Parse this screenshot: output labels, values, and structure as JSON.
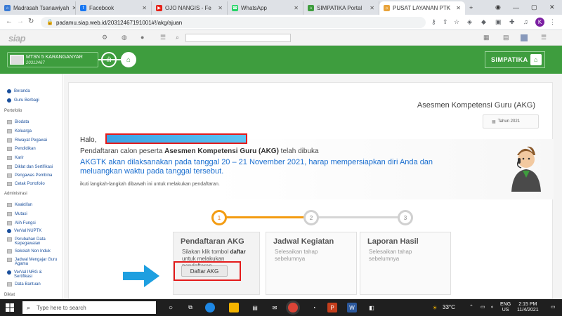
{
  "browser": {
    "tabs": [
      {
        "label": "Madrasah Tsanawiyah",
        "color": "#3a7bd5",
        "glyph": "⌂"
      },
      {
        "label": "Facebook",
        "color": "#1877f2",
        "glyph": "f"
      },
      {
        "label": "OJO NANGIS - Fe",
        "color": "#e62117",
        "glyph": "▶"
      },
      {
        "label": "WhatsApp",
        "color": "#25d366",
        "glyph": "☎"
      },
      {
        "label": "SIMPATIKA Portal",
        "color": "#3e9d3e",
        "glyph": "⌂"
      },
      {
        "label": "PUSAT LAYANAN PTK",
        "color": "#e8a33a",
        "glyph": "☼"
      }
    ],
    "new_tab": "+",
    "url": "padamu.siap.web.id/20312467191001#!/akg/ajuan",
    "profile_initial": "K"
  },
  "siap": {
    "logo": "siap"
  },
  "header": {
    "school_name": "MTSN 5 KARANGANYAR",
    "school_code": "20312467",
    "simpatika_label": "SIMPATIKA"
  },
  "sidebar": {
    "top_items": [
      "Beranda",
      "Guru Berbagi"
    ],
    "portofolio_label": "Portofolio",
    "portofolio_items": [
      "Biodata",
      "Keluarga",
      "Riwayat Pegawai",
      "Pendidikan",
      "Karir",
      "Diklat dan Sertifikasi",
      "Pengawas Pembina",
      "Cetak Portofolio"
    ],
    "administrasi_label": "Administrasi",
    "administrasi_items": [
      "Keaktifan",
      "Mutasi",
      "Alih Fungsi",
      "VerVal NUPTK",
      "Perubahan Data Kepegawaian",
      "Sekolah Non Induk",
      "Jadwal Mengajar Guru Agama",
      "VerVal INRG & Sertifikasi",
      "Data Bantuan"
    ],
    "diklat_label": "Diklat"
  },
  "main": {
    "title": "Asesmen Kompetensi Guru (AKG)",
    "tahun": "Tahun 2021",
    "greeting": "Halo,",
    "line1_pre": "Pendaftaran calon peserta ",
    "line1_bold": "Asesmen Kompetensi Guru (AKG)",
    "line1_post": " telah dibuka",
    "line2": "AKGTK akan dilaksanakan pada tanggal 20 – 21 November 2021, harap mempersiapkan diri Anda dan meluangkan waktu pada tanggal tersebut.",
    "line3": "ikuti langkah-langkah dibawah ini untuk melakukan pendaftaran."
  },
  "steps": [
    {
      "num": "1",
      "title": "Pendaftaran AKG",
      "desc_pre": "Silakan klik tombol ",
      "desc_bold": "daftar",
      "desc_post": " untuk melakukan pendaftaran",
      "active": true
    },
    {
      "num": "2",
      "title": "Jadwal Kegiatan",
      "desc": "Selesaikan tahap sebelumnya",
      "active": false
    },
    {
      "num": "3",
      "title": "Laporan Hasil",
      "desc": "Selesaikan tahap sebelumnya",
      "active": false
    }
  ],
  "register_button": "Daftar AKG",
  "taskbar": {
    "search_placeholder": "Type here to search",
    "weather": "33°C",
    "lang1": "ENG",
    "lang2": "US",
    "time": "2:15 PM",
    "date": "11/4/2021"
  },
  "colors": {
    "accent_green": "#3e9d3e",
    "step_active": "#f39c12",
    "link_blue": "#1a6ecf",
    "highlight_red": "#e41b1b",
    "arrow_blue": "#1e9fe0"
  }
}
